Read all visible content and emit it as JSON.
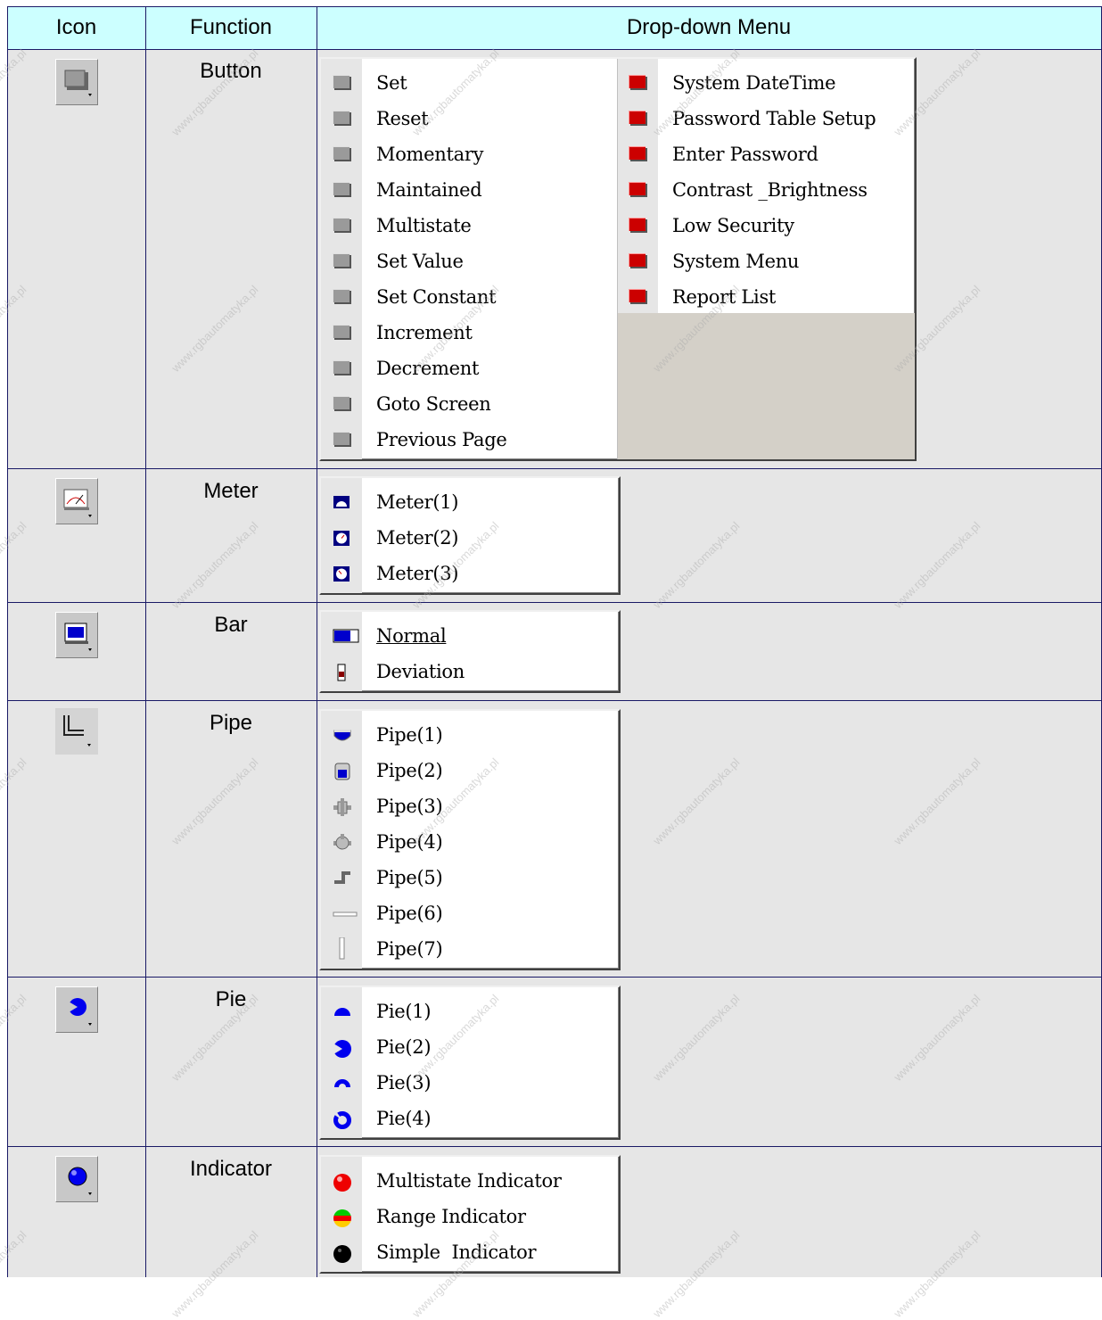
{
  "header": {
    "icon": "Icon",
    "function": "Function",
    "menu": "Drop-down Menu"
  },
  "rows": {
    "button": {
      "function": "Button",
      "icon": "button-tool-icon",
      "menu_left": [
        "Set",
        "Reset",
        "Momentary",
        "Maintained",
        "Multistate",
        "Set Value",
        "Set Constant",
        "Increment",
        "Decrement",
        "Goto Screen",
        "Previous Page"
      ],
      "menu_right": [
        "System DateTime",
        "Password Table Setup",
        "Enter Password",
        "Contrast _Brightness",
        "Low Security",
        "System Menu",
        "Report List"
      ]
    },
    "meter": {
      "function": "Meter",
      "icon": "meter-tool-icon",
      "menu": [
        "Meter(1)",
        "Meter(2)",
        "Meter(3)"
      ]
    },
    "bar": {
      "function": "Bar",
      "icon": "bar-tool-icon",
      "menu": [
        "Normal",
        "Deviation"
      ]
    },
    "pipe": {
      "function": "Pipe",
      "icon": "pipe-tool-icon",
      "menu": [
        "Pipe(1)",
        "Pipe(2)",
        "Pipe(3)",
        "Pipe(4)",
        "Pipe(5)",
        "Pipe(6)",
        "Pipe(7)"
      ]
    },
    "pie": {
      "function": "Pie",
      "icon": "pie-tool-icon",
      "menu": [
        "Pie(1)",
        "Pie(2)",
        "Pie(3)",
        "Pie(4)"
      ]
    },
    "indicator": {
      "function": "Indicator",
      "icon": "indicator-tool-icon",
      "menu": [
        "Multistate Indicator",
        "Range Indicator",
        "Simple  Indicator"
      ]
    }
  },
  "watermark": "www.rgbautomatyka.pl",
  "colors": {
    "header_bg": "#ccffff",
    "cell_bg": "#e6e6e6",
    "grid": "#1a1a66"
  }
}
